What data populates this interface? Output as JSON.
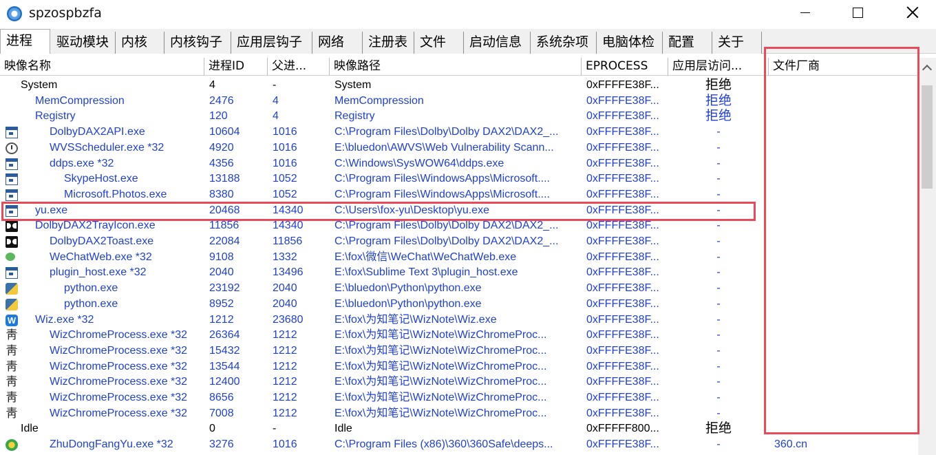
{
  "window": {
    "title": "spzospbzfa",
    "app_icon": "app-logo-icon"
  },
  "tabs": [
    {
      "label": "进程",
      "active": true
    },
    {
      "label": "驱动模块"
    },
    {
      "label": "内核"
    },
    {
      "label": "内核钩子"
    },
    {
      "label": "应用层钩子"
    },
    {
      "label": "网络"
    },
    {
      "label": "注册表"
    },
    {
      "label": "文件"
    },
    {
      "label": "启动信息"
    },
    {
      "label": "系统杂项"
    },
    {
      "label": "电脑体检"
    },
    {
      "label": "配置"
    },
    {
      "label": "关于"
    }
  ],
  "columns": [
    "映像名称",
    "进程ID",
    "父进...",
    "映像路径",
    "EPROCESS",
    "应用层访问...",
    "文件厂商"
  ],
  "rows": [
    {
      "name": "System",
      "indent": 0,
      "icon": "none",
      "pid": "4",
      "ppid": "-",
      "path": "System",
      "eprocess": "0xFFFFE38F...",
      "access": "拒绝",
      "vendor": "",
      "color": "#000000"
    },
    {
      "name": "MemCompression",
      "indent": 1,
      "icon": "none",
      "pid": "2476",
      "ppid": "4",
      "path": "MemCompression",
      "eprocess": "0xFFFFE38F...",
      "access": "拒绝",
      "vendor": "",
      "color": "#1f3fd6"
    },
    {
      "name": "Registry",
      "indent": 1,
      "icon": "none",
      "pid": "120",
      "ppid": "4",
      "path": "Registry",
      "eprocess": "0xFFFFE38F...",
      "access": "拒绝",
      "vendor": "",
      "color": "#1f3fd6"
    },
    {
      "name": "DolbyDAX2API.exe",
      "indent": 2,
      "icon": "window",
      "pid": "10604",
      "ppid": "1016",
      "path": "C:\\Program Files\\Dolby\\Dolby DAX2\\DAX2_...",
      "eprocess": "0xFFFFE38F...",
      "access": "-",
      "vendor": "",
      "color": "#1f3fd6"
    },
    {
      "name": "WVSScheduler.exe *32",
      "indent": 2,
      "icon": "clock",
      "pid": "4920",
      "ppid": "1016",
      "path": "E:\\bluedon\\AWVS\\Web Vulnerability Scann...",
      "eprocess": "0xFFFFE38F...",
      "access": "-",
      "vendor": "",
      "color": "#1f3fd6"
    },
    {
      "name": "ddps.exe *32",
      "indent": 2,
      "icon": "window",
      "pid": "4356",
      "ppid": "1016",
      "path": "C:\\Windows\\SysWOW64\\ddps.exe",
      "eprocess": "0xFFFFE38F...",
      "access": "-",
      "vendor": "",
      "color": "#1f3fd6"
    },
    {
      "name": "SkypeHost.exe",
      "indent": 3,
      "icon": "window",
      "pid": "13188",
      "ppid": "1052",
      "path": "C:\\Program Files\\WindowsApps\\Microsoft....",
      "eprocess": "0xFFFFE38F...",
      "access": "-",
      "vendor": "",
      "color": "#1f3fd6"
    },
    {
      "name": "Microsoft.Photos.exe",
      "indent": 3,
      "icon": "window",
      "pid": "8380",
      "ppid": "1052",
      "path": "C:\\Program Files\\WindowsApps\\Microsoft....",
      "eprocess": "0xFFFFE38F...",
      "access": "-",
      "vendor": "",
      "color": "#1f3fd6"
    },
    {
      "name": "yu.exe",
      "indent": 1,
      "icon": "window",
      "pid": "20468",
      "ppid": "14340",
      "path": "C:\\Users\\fox-yu\\Desktop\\yu.exe",
      "eprocess": "0xFFFFE38F...",
      "access": "-",
      "vendor": "",
      "color": "#1f3fd6"
    },
    {
      "name": "DolbyDAX2TrayIcon.exe",
      "indent": 1,
      "icon": "dolby",
      "pid": "11856",
      "ppid": "14340",
      "path": "C:\\Program Files\\Dolby\\Dolby DAX2\\DAX2_...",
      "eprocess": "0xFFFFE38F...",
      "access": "-",
      "vendor": "",
      "color": "#1f3fd6"
    },
    {
      "name": "DolbyDAX2Toast.exe",
      "indent": 2,
      "icon": "dolby",
      "pid": "22084",
      "ppid": "11856",
      "path": "C:\\Program Files\\Dolby\\Dolby DAX2\\DAX2_...",
      "eprocess": "0xFFFFE38F...",
      "access": "-",
      "vendor": "",
      "color": "#1f3fd6"
    },
    {
      "name": "WeChatWeb.exe *32",
      "indent": 2,
      "icon": "wechat",
      "pid": "9108",
      "ppid": "1332",
      "path": "E:\\fox\\微信\\WeChat\\WeChatWeb.exe",
      "eprocess": "0xFFFFE38F...",
      "access": "-",
      "vendor": "",
      "color": "#1f3fd6"
    },
    {
      "name": "plugin_host.exe *32",
      "indent": 2,
      "icon": "window",
      "pid": "2040",
      "ppid": "13496",
      "path": "E:\\fox\\Sublime Text 3\\plugin_host.exe",
      "eprocess": "0xFFFFE38F...",
      "access": "-",
      "vendor": "",
      "color": "#1f3fd6"
    },
    {
      "name": "python.exe",
      "indent": 3,
      "icon": "python",
      "pid": "23192",
      "ppid": "2040",
      "path": "E:\\bluedon\\Python\\python.exe",
      "eprocess": "0xFFFFE38F...",
      "access": "-",
      "vendor": "",
      "color": "#1f3fd6"
    },
    {
      "name": "python.exe",
      "indent": 3,
      "icon": "python",
      "pid": "8952",
      "ppid": "2040",
      "path": "E:\\bluedon\\Python\\python.exe",
      "eprocess": "0xFFFFE38F...",
      "access": "-",
      "vendor": "",
      "color": "#1f3fd6"
    },
    {
      "name": "Wiz.exe *32",
      "indent": 1,
      "icon": "wiz",
      "pid": "1212",
      "ppid": "23680",
      "path": "E:\\fox\\为知笔记\\WizNote\\Wiz.exe",
      "eprocess": "0xFFFFE38F...",
      "access": "-",
      "vendor": "",
      "color": "#1f3fd6"
    },
    {
      "name": "WizChromeProcess.exe *32",
      "indent": 2,
      "icon": "chrome",
      "pid": "26364",
      "ppid": "1212",
      "path": "E:\\fox\\为知笔记\\WizNote\\WizChromeProc...",
      "eprocess": "0xFFFFE38F...",
      "access": "-",
      "vendor": "",
      "color": "#1f3fd6"
    },
    {
      "name": "WizChromeProcess.exe *32",
      "indent": 2,
      "icon": "chrome",
      "pid": "15432",
      "ppid": "1212",
      "path": "E:\\fox\\为知笔记\\WizNote\\WizChromeProc...",
      "eprocess": "0xFFFFE38F...",
      "access": "-",
      "vendor": "",
      "color": "#1f3fd6"
    },
    {
      "name": "WizChromeProcess.exe *32",
      "indent": 2,
      "icon": "chrome",
      "pid": "13544",
      "ppid": "1212",
      "path": "E:\\fox\\为知笔记\\WizNote\\WizChromeProc...",
      "eprocess": "0xFFFFE38F...",
      "access": "-",
      "vendor": "",
      "color": "#1f3fd6"
    },
    {
      "name": "WizChromeProcess.exe *32",
      "indent": 2,
      "icon": "chrome",
      "pid": "12400",
      "ppid": "1212",
      "path": "E:\\fox\\为知笔记\\WizNote\\WizChromeProc...",
      "eprocess": "0xFFFFE38F...",
      "access": "-",
      "vendor": "",
      "color": "#1f3fd6"
    },
    {
      "name": "WizChromeProcess.exe *32",
      "indent": 2,
      "icon": "chrome",
      "pid": "8656",
      "ppid": "1212",
      "path": "E:\\fox\\为知笔记\\WizNote\\WizChromeProc...",
      "eprocess": "0xFFFFE38F...",
      "access": "-",
      "vendor": "",
      "color": "#1f3fd6"
    },
    {
      "name": "WizChromeProcess.exe *32",
      "indent": 2,
      "icon": "chrome",
      "pid": "7008",
      "ppid": "1212",
      "path": "E:\\fox\\为知笔记\\WizNote\\WizChromeProc...",
      "eprocess": "0xFFFFE38F...",
      "access": "-",
      "vendor": "",
      "color": "#1f3fd6"
    },
    {
      "name": "Idle",
      "indent": 0,
      "icon": "none",
      "pid": "0",
      "ppid": "-",
      "path": "Idle",
      "eprocess": "0xFFFFF800...",
      "access": "拒绝",
      "vendor": "",
      "color": "#000000"
    },
    {
      "name": "ZhuDongFangYu.exe *32",
      "indent": 2,
      "icon": "360",
      "pid": "3276",
      "ppid": "1016",
      "path": "C:\\Program Files (x86)\\360\\360Safe\\deeps...",
      "eprocess": "0xFFFFE38F...",
      "access": "-",
      "vendor": "360.cn",
      "color": "#1f3fd6"
    }
  ],
  "colors": {
    "process_blue": "#1f3fd6",
    "highlight_red": "#e84a5a",
    "tab_bg": "#f0f0f0"
  }
}
